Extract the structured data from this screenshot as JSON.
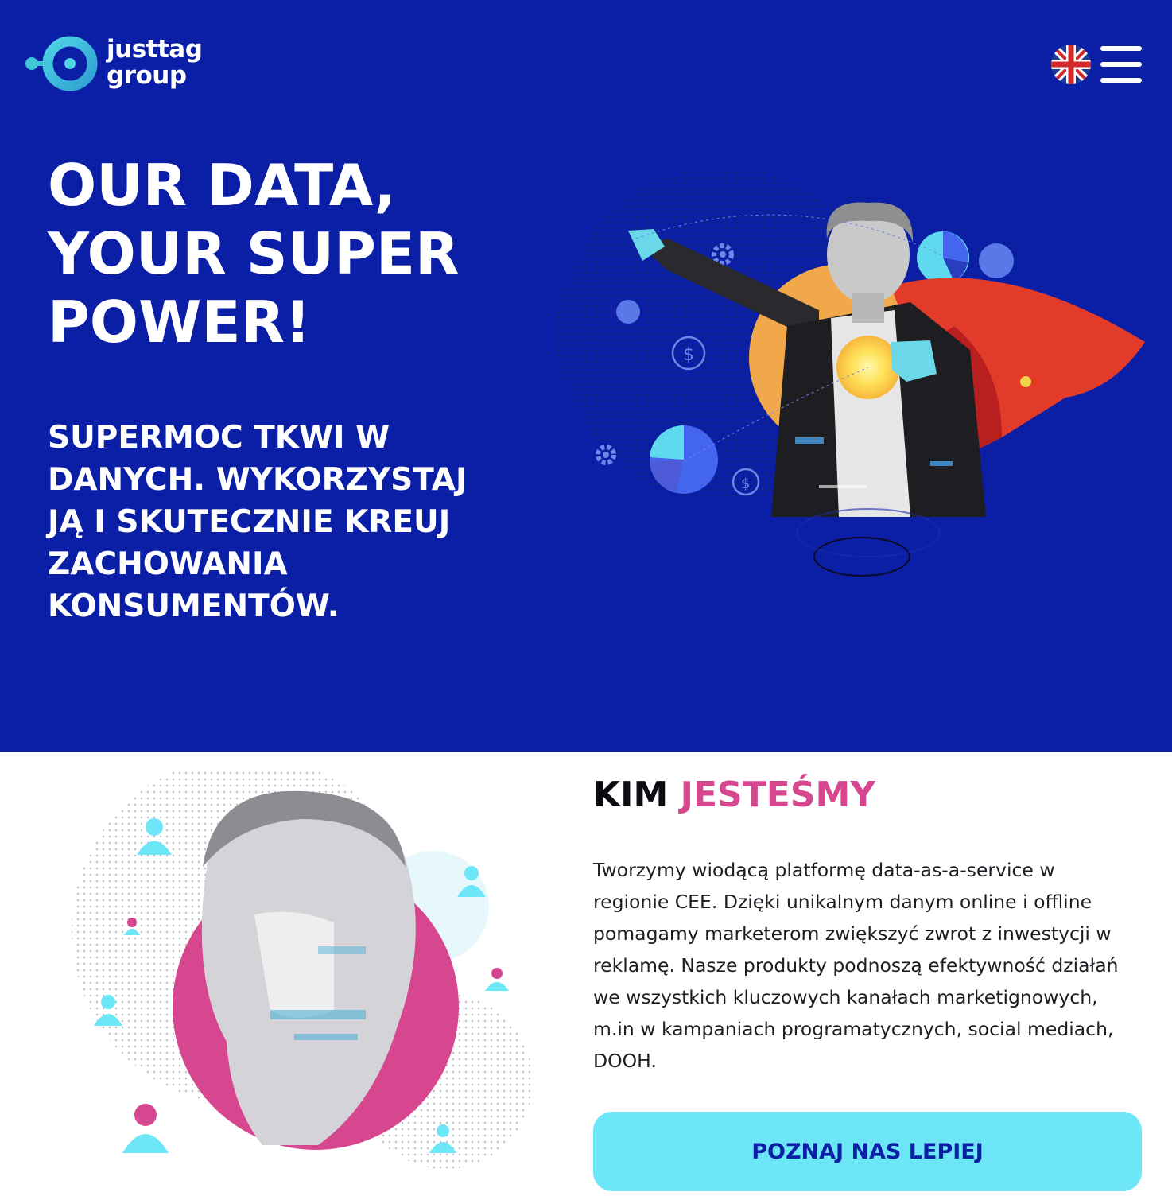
{
  "header": {
    "logo_line1": "justtag",
    "logo_line2": "group",
    "language_flag": "uk-flag-icon",
    "menu_icon": "hamburger-menu-icon"
  },
  "hero": {
    "title_line1": "OUR DATA,",
    "title_line2": "YOUR SUPER",
    "title_line3": "POWER!",
    "subtitle_line1": "SUPERMOC TKWI W",
    "subtitle_line2": "DANYCH. WYKORZYSTAJ",
    "subtitle_line3": "JĄ I SKUTECZNIE KREUJ",
    "subtitle_line4": "ZACHOWANIA",
    "subtitle_line5": "KONSUMENTÓW."
  },
  "about": {
    "heading_part1": "KIM",
    "heading_part2": "JESTEŚMY",
    "body_line1": "Tworzymy wiodącą platformę data-as-a-service w",
    "body_line2": "regionie CEE. Dzięki unikalnym danym online i offline",
    "body_line3": "pomagamy marketerom zwiększyć zwrot z inwestycji w",
    "body_line4": "reklamę. Nasze produkty podnoszą efektywność działań",
    "body_line5": "we wszystkich kluczowych kanałach marketignowych,",
    "body_line6": "m.in w kampaniach programatycznych, social mediach,",
    "body_line7": "DOOH.",
    "cta_label": "POZNAJ NAS LEPIEJ"
  },
  "colors": {
    "hero_background": "#0a1fa6",
    "logo_accent": "#3fc6d8",
    "heading_accent": "#d6478f",
    "cta_background": "#6de6f7",
    "cta_text": "#0a1fa6"
  }
}
